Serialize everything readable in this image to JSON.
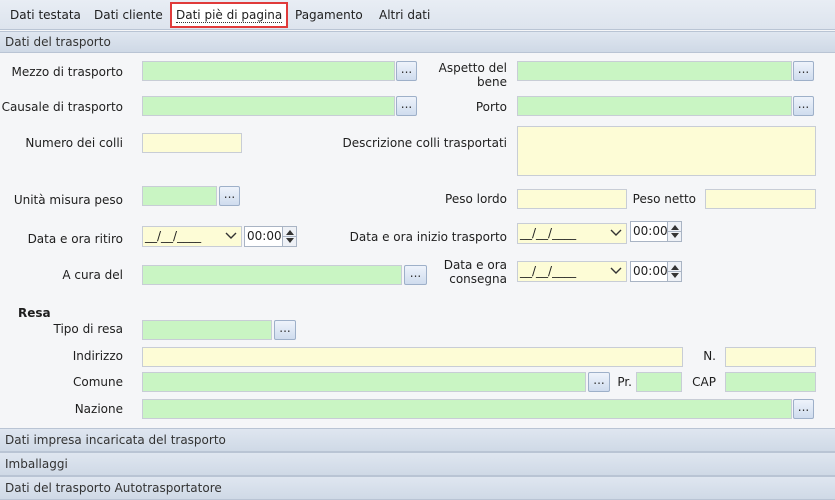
{
  "tabs": [
    "Dati testata",
    "Dati cliente",
    "Dati piè di pagina",
    "Pagamento",
    "Altri dati"
  ],
  "sections": {
    "trasporto": "Dati del trasporto",
    "impresa": "Dati impresa incaricata del trasporto",
    "imballaggi": "Imballaggi",
    "autotrasportatore": "Dati del trasporto Autotrasportatore"
  },
  "labels": {
    "mezzo": "Mezzo di trasporto",
    "aspetto": "Aspetto del bene",
    "causale": "Causale di trasporto",
    "porto": "Porto",
    "numero_colli": "Numero dei colli",
    "descrizione_colli": "Descrizione colli trasportati",
    "unita_peso": "Unità misura peso",
    "peso_lordo": "Peso lordo",
    "peso_netto": "Peso netto",
    "data_ritiro": "Data e ora ritiro",
    "data_inizio": "Data e ora inizio trasporto",
    "a_cura": "A cura del",
    "data_consegna": "Data e ora consegna",
    "resa": "Resa",
    "tipo_resa": "Tipo di resa",
    "indirizzo": "Indirizzo",
    "numero": "N.",
    "comune": "Comune",
    "provincia": "Pr.",
    "cap": "CAP",
    "nazione": "Nazione"
  },
  "lookup_label": "...",
  "date_placeholder": "__/__/____",
  "times": {
    "ritiro": "00:00",
    "inizio": "00:00",
    "consegna": "00:00"
  },
  "colors": {
    "required_field": "#c9f5c3",
    "optional_field": "#fdfcd6",
    "active_tab_outline": "#e03a3a"
  }
}
